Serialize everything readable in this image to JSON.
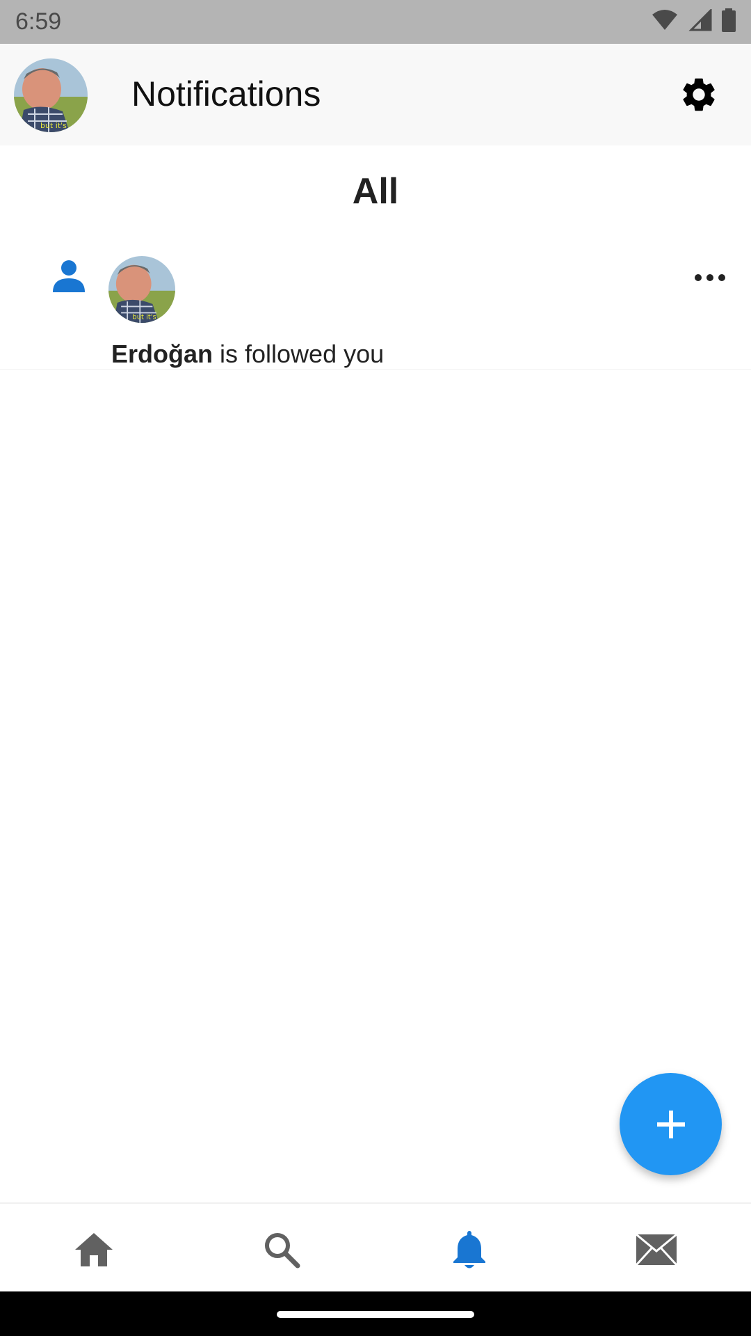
{
  "status_bar": {
    "time": "6:59",
    "icons": [
      "wifi-icon",
      "signal-icon",
      "battery-icon"
    ]
  },
  "app_bar": {
    "title": "Notifications",
    "avatar_caption": "but it's"
  },
  "tabs": {
    "current": "All"
  },
  "notifications": [
    {
      "type_icon": "person-icon",
      "user": "Erdoğan",
      "message": " is followed you"
    }
  ],
  "bottom_nav": {
    "items": [
      "home-icon",
      "search-icon",
      "bell-icon",
      "mail-icon"
    ],
    "active": "bell-icon"
  },
  "colors": {
    "accent": "#2196f3",
    "icon_active": "#1976d2",
    "icon_inactive": "#616161"
  }
}
